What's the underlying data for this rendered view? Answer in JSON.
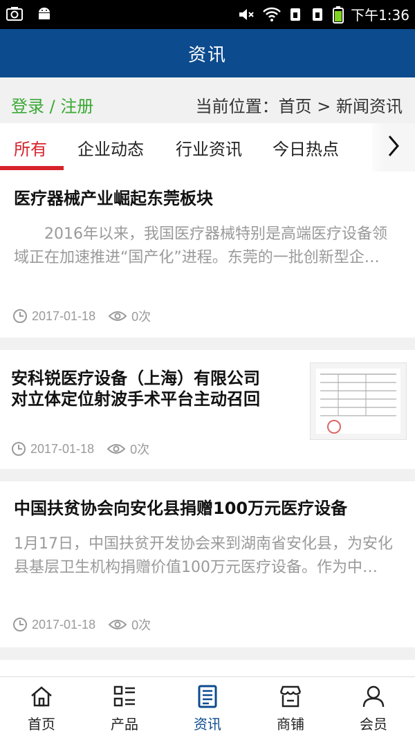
{
  "status_bar": {
    "time": "下午1:36",
    "icons": [
      "camera-icon",
      "android-icon",
      "mute-icon",
      "wifi-icon",
      "sim1-icon",
      "sim2-icon",
      "battery-icon"
    ]
  },
  "app_bar": {
    "title": "资讯"
  },
  "location_bar": {
    "login": "登录 / 注册",
    "breadcrumb": "当前位置：首页 > 新闻资讯"
  },
  "tabs": {
    "items": [
      {
        "label": "所有",
        "active": true
      },
      {
        "label": "企业动态"
      },
      {
        "label": "行业资讯"
      },
      {
        "label": "今日热点"
      }
    ],
    "more_icon": "chevron-right-icon"
  },
  "news": [
    {
      "title": "医疗器械产业崛起东莞板块",
      "summary": "　　2016年以来，我国医疗器械特别是高端医疗设备领域正在加速推进“国产化”进程。东莞的一批创新型企…",
      "date": "2017-01-18",
      "views": "0次"
    },
    {
      "title_line1": "安科锐医疗设备（上海）有限公司",
      "title_line2": "对立体定位射波手术平台主动召回",
      "date": "2017-01-18",
      "views": "0次",
      "has_thumbnail": true
    },
    {
      "title": "中国扶贫协会向安化县捐赠100万元医疗设备",
      "summary": "1月17日，中国扶贫开发协会来到湖南省安化县，为安化县基层卫生机构捐赠价值100万元医疗设备。作为中…",
      "date": "2017-01-18",
      "views": "0次"
    }
  ],
  "bottom_nav": [
    {
      "label": "首页",
      "icon": "home-icon"
    },
    {
      "label": "产品",
      "icon": "grid-list-icon"
    },
    {
      "label": "资讯",
      "icon": "news-icon",
      "active": true
    },
    {
      "label": "商铺",
      "icon": "shop-icon"
    },
    {
      "label": "会员",
      "icon": "user-icon"
    }
  ],
  "colors": {
    "app_bar": "#0c4b8e",
    "active_tab": "#d6232b",
    "login_link": "#3aa935",
    "active_nav": "#0c4b8e",
    "muted_text": "#9a9a9a"
  }
}
